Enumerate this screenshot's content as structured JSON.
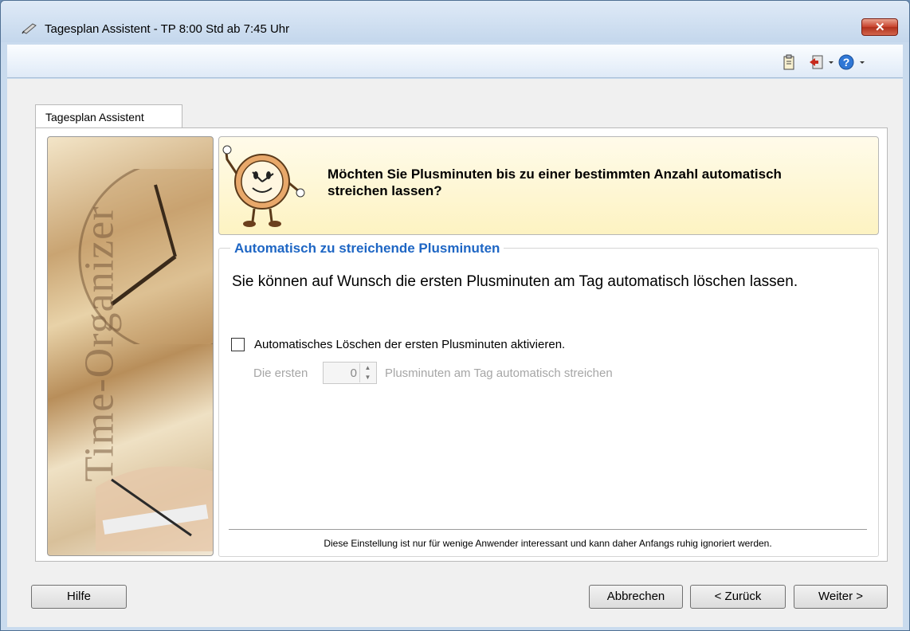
{
  "window": {
    "title": "Tagesplan Assistent - TP 8:00 Std ab 7:45 Uhr",
    "close_symbol": "✕"
  },
  "toolbar": {
    "icons": [
      "clipboard-icon",
      "exit-icon",
      "dropdown-arrow-icon",
      "help-icon",
      "dropdown-arrow-icon"
    ]
  },
  "tab": {
    "label": "Tagesplan Assistent"
  },
  "side_image": {
    "text": "Time-Organizer"
  },
  "header": {
    "question": "Möchten Sie Plusminuten bis zu einer bestimmten Anzahl automatisch streichen lassen?"
  },
  "group": {
    "title": "Automatisch zu streichende Plusminuten",
    "description": "Sie können auf Wunsch die ersten Plusminuten am Tag automatisch löschen lassen.",
    "checkbox_label": "Automatisches Löschen der ersten Plusminuten aktivieren.",
    "checkbox_checked": false,
    "first_label": "Die ersten",
    "spin_value": "0",
    "after_label": "Plusminuten am Tag automatisch streichen",
    "hint": "Diese Einstellung ist nur für wenige Anwender interessant und kann daher Anfangs ruhig ignoriert werden."
  },
  "buttons": {
    "help": "Hilfe",
    "cancel": "Abbrechen",
    "back": "< Zurück",
    "next": "Weiter >"
  },
  "colors": {
    "group_title": "#1e66c4",
    "header_bg": "#fdf3c2",
    "close_button": "#c7402b"
  }
}
